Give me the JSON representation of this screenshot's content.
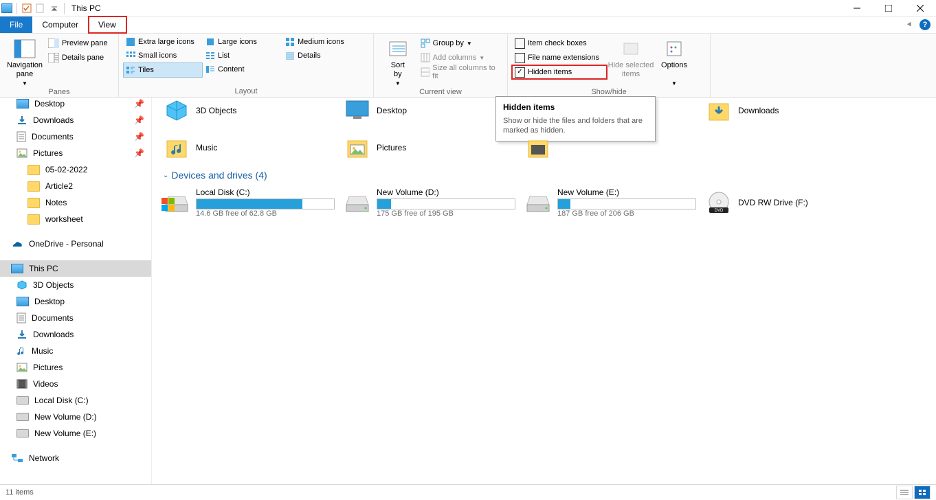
{
  "window": {
    "title": "This PC"
  },
  "tabs": {
    "file": "File",
    "computer": "Computer",
    "view": "View"
  },
  "ribbon": {
    "panes": {
      "nav_label": "Navigation\npane",
      "preview": "Preview pane",
      "details": "Details pane",
      "group": "Panes"
    },
    "layout": {
      "xl": "Extra large icons",
      "large": "Large icons",
      "medium": "Medium icons",
      "small": "Small icons",
      "list": "List",
      "details": "Details",
      "tiles": "Tiles",
      "content": "Content",
      "group": "Layout"
    },
    "current": {
      "sort": "Sort\nby",
      "group_by": "Group by",
      "add_cols": "Add columns",
      "size_all": "Size all columns to fit",
      "group": "Current view"
    },
    "showhide": {
      "item_check": "Item check boxes",
      "file_ext": "File name extensions",
      "hidden": "Hidden items",
      "hide_sel": "Hide selected\nitems",
      "options": "Options",
      "group": "Show/hide"
    }
  },
  "tooltip": {
    "title": "Hidden items",
    "body": "Show or hide the files and folders that are marked as hidden."
  },
  "nav": {
    "quick": [
      "Desktop",
      "Downloads",
      "Documents",
      "Pictures",
      "05-02-2022",
      "Article2",
      "Notes",
      "worksheet"
    ],
    "onedrive": "OneDrive - Personal",
    "thispc": "This PC",
    "thispc_items": [
      "3D Objects",
      "Desktop",
      "Documents",
      "Downloads",
      "Music",
      "Pictures",
      "Videos",
      "Local Disk (C:)",
      "New Volume (D:)",
      "New Volume (E:)"
    ],
    "network": "Network"
  },
  "folders_row1": [
    "3D Objects",
    "Desktop",
    "",
    "Downloads"
  ],
  "folders_row2": [
    "Music",
    "Pictures",
    "",
    ""
  ],
  "section_devices": "Devices and drives (4)",
  "drives": [
    {
      "name": "Local Disk (C:)",
      "sub": "14.6 GB free of 62.8 GB",
      "pct": 77
    },
    {
      "name": "New Volume (D:)",
      "sub": "175 GB free of 195 GB",
      "pct": 10
    },
    {
      "name": "New Volume (E:)",
      "sub": "187 GB free of 206 GB",
      "pct": 9
    },
    {
      "name": "DVD RW Drive (F:)",
      "sub": "",
      "pct": -1
    }
  ],
  "status": {
    "count": "11 items"
  }
}
